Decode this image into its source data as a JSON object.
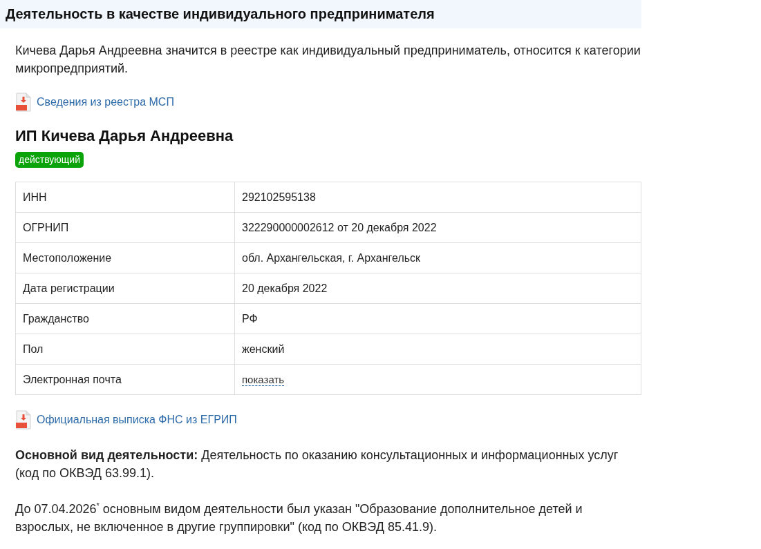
{
  "section": {
    "title": "Деятельность в качестве индивидуального предпринимателя"
  },
  "summary": "Кичева Дарья Андреевна значится в реестре как индивидуальный предприниматель, относится к категории микропредприятий.",
  "msp_link": {
    "label": "Сведения из реестра МСП"
  },
  "entity": {
    "name": "ИП Кичева Дарья Андреевна",
    "status": "действующий"
  },
  "details": {
    "rows": [
      {
        "label": "ИНН",
        "value": "292102595138",
        "kind": "text"
      },
      {
        "label": "ОГРНИП",
        "value": "322290000002612 от 20 декабря 2022",
        "kind": "text"
      },
      {
        "label": "Местоположение",
        "value": "обл. Архангельская, г. Архангельск",
        "kind": "text"
      },
      {
        "label": "Дата регистрации",
        "value": "20 декабря 2022",
        "kind": "text"
      },
      {
        "label": "Гражданство",
        "value": "РФ",
        "kind": "text"
      },
      {
        "label": "Пол",
        "value": "женский",
        "kind": "text"
      },
      {
        "label": "Электронная почта",
        "value": "показать",
        "kind": "reveal"
      }
    ]
  },
  "egrip_link": {
    "label": "Официальная выписка ФНС из ЕГРИП"
  },
  "main_activity": "**Основной вид деятельности:** Деятельность по оказанию консультационных и информационных услуг (код по ОКВЭД 63.99.1).",
  "previous_activity": "До 07.04.2026$^{*}$ основным видом деятельности был указан \"Образование дополнительное детей и взрослых, не включенное в другие группировки\" (код по ОКВЭД 85.41.9)."
}
